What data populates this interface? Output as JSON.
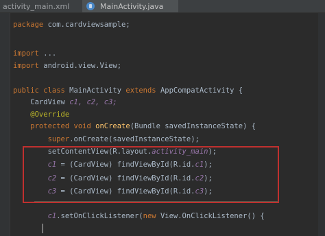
{
  "tabs": [
    {
      "label": "activity_main.xml",
      "active": false
    },
    {
      "label": "MainActivity.java",
      "active": true,
      "icon": "class-icon"
    }
  ],
  "code_lines": [
    {
      "parts": [
        {
          "cls": "kw",
          "text": "package"
        },
        {
          "cls": "pa",
          "text": " com.cardviewsample;"
        }
      ]
    },
    {
      "parts": [
        {
          "cls": "kw",
          "text": "import"
        },
        {
          "cls": "pa",
          "text": " ..."
        }
      ]
    },
    {
      "parts": [
        {
          "cls": "kw",
          "text": "import"
        },
        {
          "cls": "pa",
          "text": " android.view.View;"
        }
      ]
    },
    {
      "parts": [
        {
          "cls": "kw",
          "text": "public class"
        },
        {
          "cls": "pa",
          "text": " MainActivity "
        },
        {
          "cls": "kw",
          "text": "extends"
        },
        {
          "cls": "pa",
          "text": " AppCompatActivity {"
        }
      ]
    },
    {
      "parts": [
        {
          "cls": "pa",
          "text": "    CardView "
        },
        {
          "cls": "it",
          "text": "c1, c2, c3;"
        }
      ]
    },
    {
      "parts": [
        {
          "cls": "an",
          "text": "    @Override"
        }
      ]
    },
    {
      "parts": [
        {
          "cls": "kw",
          "text": "    protected void"
        },
        {
          "cls": "fn",
          "text": " onCreate"
        },
        {
          "cls": "pa",
          "text": "(Bundle savedInstanceState) {"
        }
      ]
    },
    {
      "parts": [
        {
          "cls": "kw",
          "text": "        super"
        },
        {
          "cls": "pa",
          "text": ".onCreate(savedInstanceState);"
        }
      ]
    },
    {
      "parts": [
        {
          "cls": "pa",
          "text": "        setContentView(R.layout."
        },
        {
          "cls": "it",
          "text": "activity_main"
        },
        {
          "cls": "pa",
          "text": ");"
        }
      ]
    },
    {
      "parts": [
        {
          "cls": "it",
          "text": "        c1"
        },
        {
          "cls": "pa",
          "text": " = (CardView) findViewById(R.id."
        },
        {
          "cls": "it",
          "text": "c1"
        },
        {
          "cls": "pa",
          "text": ");"
        }
      ]
    },
    {
      "parts": [
        {
          "cls": "it",
          "text": "        c2"
        },
        {
          "cls": "pa",
          "text": " = (CardView) findViewById(R.id."
        },
        {
          "cls": "it",
          "text": "c2"
        },
        {
          "cls": "pa",
          "text": ");"
        }
      ]
    },
    {
      "parts": [
        {
          "cls": "it",
          "text": "        c3"
        },
        {
          "cls": "pa",
          "text": " = (CardView) findViewById(R.id."
        },
        {
          "cls": "it",
          "text": "c3"
        },
        {
          "cls": "pa",
          "text": ");"
        }
      ]
    },
    {
      "parts": [
        {
          "cls": "it",
          "text": "        c1"
        },
        {
          "cls": "pa",
          "text": ".setOnClickListener("
        },
        {
          "cls": "kw",
          "text": "new"
        },
        {
          "cls": "pa",
          "text": " View.OnClickListener() {"
        }
      ]
    }
  ],
  "highlight_color": "#c0302f"
}
